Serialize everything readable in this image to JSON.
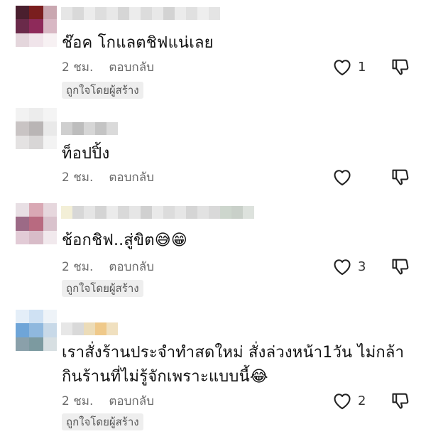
{
  "comments": [
    {
      "text": "ช๊อค โกแลตชิฟแน่เลย",
      "time": "2 ชม.",
      "reply_label": "ตอบกลับ",
      "like_count": "1",
      "liked_by_creator": "ถูกใจโดยผู้สร้าง"
    },
    {
      "text": "ท็อปปิ้ง",
      "time": "2 ชม.",
      "reply_label": "ตอบกลับ",
      "like_count": "",
      "liked_by_creator": ""
    },
    {
      "text": "ช้อกชิฟ..สู่ขิต😅😁",
      "time": "2 ชม.",
      "reply_label": "ตอบกลับ",
      "like_count": "3",
      "liked_by_creator": "ถูกใจโดยผู้สร้าง"
    },
    {
      "text_line1": "เราสั่งร้านประจำทำสดใหม่ สั่งล่วงหน้า1วัน ไม่กล้า",
      "text_line2": "กินร้านที่ไม่รู้จักเพราะแบบนี้😂",
      "time": "2 ชม.",
      "reply_label": "ตอบกลับ",
      "like_count": "2",
      "liked_by_creator": "ถูกใจโดยผู้สร้าง"
    }
  ],
  "icons": {
    "like": "heart-outline-icon",
    "dislike": "thumbs-down-outline-icon"
  },
  "colors": {
    "meta": "#6b6b6b",
    "badge_bg": "#eeeeee"
  }
}
